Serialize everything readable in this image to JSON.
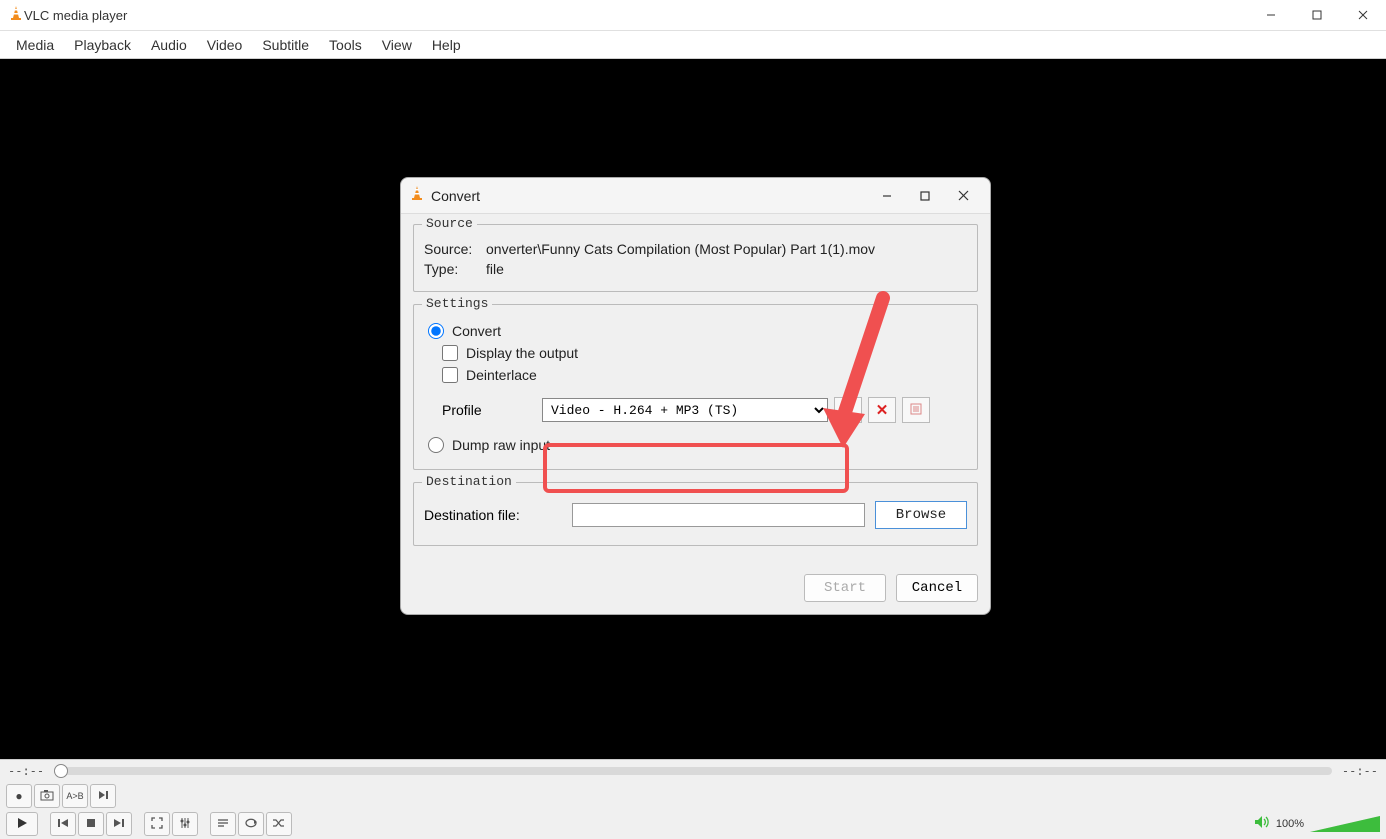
{
  "window": {
    "title": "VLC media player",
    "menus": [
      "Media",
      "Playback",
      "Audio",
      "Video",
      "Subtitle",
      "Tools",
      "View",
      "Help"
    ]
  },
  "dialog": {
    "title": "Convert",
    "source": {
      "legend": "Source",
      "source_label": "Source:",
      "source_value": "onverter\\Funny Cats Compilation (Most Popular) Part 1(1).mov",
      "type_label": "Type:",
      "type_value": "file"
    },
    "settings": {
      "legend": "Settings",
      "convert_label": "Convert",
      "display_output_label": "Display the output",
      "deinterlace_label": "Deinterlace",
      "profile_label": "Profile",
      "profile_value": "Video - H.264 + MP3 (TS)",
      "dump_raw_label": "Dump raw input"
    },
    "destination": {
      "legend": "Destination",
      "file_label": "Destination file:",
      "browse_label": "Browse"
    },
    "buttons": {
      "start": "Start",
      "cancel": "Cancel"
    }
  },
  "player": {
    "time_elapsed": "--:--",
    "time_total": "--:--",
    "volume_text": "100%"
  }
}
